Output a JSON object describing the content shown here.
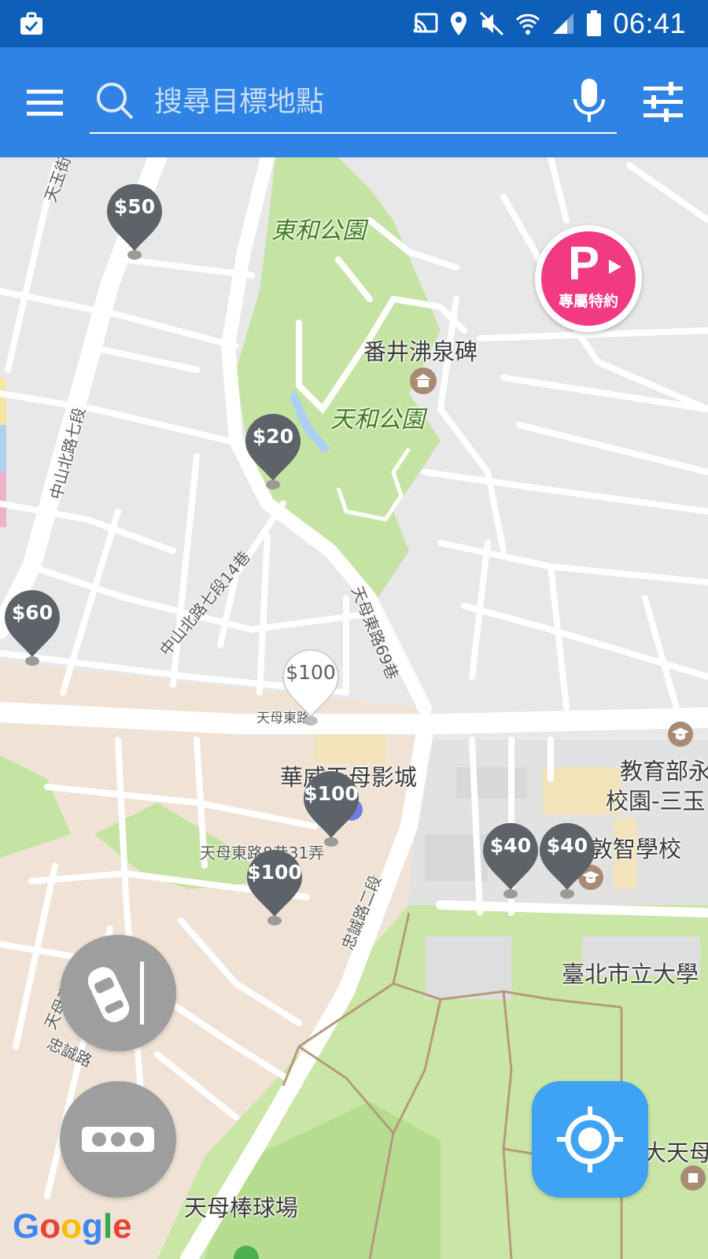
{
  "status_bar": {
    "time": "06:41",
    "icons": [
      "briefcase-check-icon",
      "cast-icon",
      "location-icon",
      "mute-icon",
      "wifi-icon",
      "signal-icon",
      "battery-icon"
    ]
  },
  "top_bar": {
    "search_placeholder": "搜尋目標地點",
    "icons": [
      "menu-icon",
      "search-icon",
      "mic-icon",
      "filter-sliders-icon"
    ],
    "accent_color": "#2f83e4"
  },
  "map": {
    "parks": [
      {
        "id": "donghe",
        "label": "東和公園"
      },
      {
        "id": "tianhe",
        "label": "天和公園"
      }
    ],
    "pois": [
      {
        "id": "fanjing",
        "label": "番井沸泉碑"
      },
      {
        "id": "cinema",
        "label": "華威天母影城"
      },
      {
        "id": "edu",
        "label": "教育部永"
      },
      {
        "id": "campus",
        "label": "校園-三玉"
      },
      {
        "id": "minzhi",
        "label": "敦智學校"
      },
      {
        "id": "univ",
        "label": "臺北市立大學"
      },
      {
        "id": "datianmu",
        "label": "大天母"
      },
      {
        "id": "baseball",
        "label": "天母棒球場"
      }
    ],
    "roads": [
      {
        "id": "tianyu",
        "label": "天玉街"
      },
      {
        "id": "zhongshan7",
        "label": "中山北路七段"
      },
      {
        "id": "zhongshan7-14",
        "label": "中山北路七段14巷"
      },
      {
        "id": "tianmu-e69",
        "label": "天母東路69巷"
      },
      {
        "id": "tianmu-e",
        "label": "天母東路"
      },
      {
        "id": "tianmu-e8-31",
        "label": "天母東路8巷31弄"
      },
      {
        "id": "zhongcheng2",
        "label": "忠誠路二段"
      },
      {
        "id": "tianmu-e-left",
        "label": "天母東路"
      },
      {
        "id": "zhongcheng",
        "label": "忠誠路"
      }
    ],
    "price_pins": [
      {
        "id": "p50",
        "label": "$50",
        "style": "dark"
      },
      {
        "id": "p20",
        "label": "$20",
        "style": "dark"
      },
      {
        "id": "p60",
        "label": "$60",
        "style": "dark"
      },
      {
        "id": "p100a",
        "label": "$100",
        "style": "light"
      },
      {
        "id": "p100b",
        "label": "$100",
        "style": "dark"
      },
      {
        "id": "p100c",
        "label": "$100",
        "style": "dark"
      },
      {
        "id": "p40a",
        "label": "$40",
        "style": "dark"
      },
      {
        "id": "p40b",
        "label": "$40",
        "style": "dark"
      }
    ],
    "colors": {
      "land": "#e8e8e8",
      "park": "#c5e4a3",
      "urban": "#f0e3d6",
      "road": "#ffffff",
      "pin_dark": "#5e6369",
      "pin_light": "#ffffff"
    }
  },
  "promo_button": {
    "letter": "P",
    "label": "專屬特約",
    "color": "#f23a83"
  },
  "controls": {
    "car_parking_icon": "car-parking-icon",
    "more_icon": "more-dots-icon",
    "locate_icon": "locate-crosshair-icon",
    "locate_color": "#3ea2f5"
  },
  "attribution": {
    "google": [
      "G",
      "o",
      "o",
      "g",
      "l",
      "e"
    ]
  }
}
